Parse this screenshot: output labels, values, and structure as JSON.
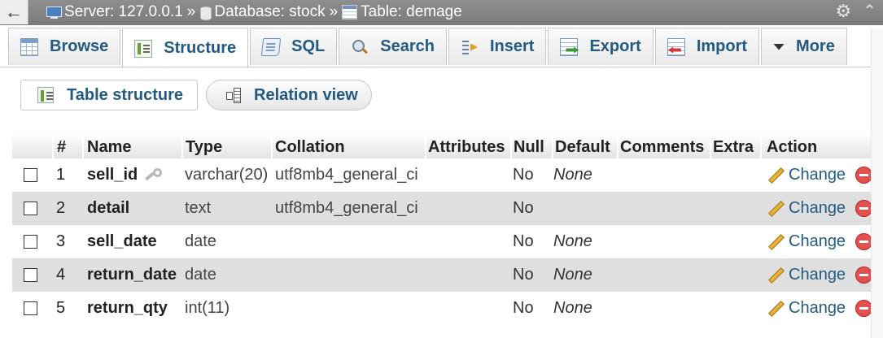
{
  "topbar": {
    "back_label": "←",
    "breadcrumbs": [
      {
        "label": "Server: 127.0.0.1",
        "icon": "server-icon"
      },
      {
        "label": "Database: stock",
        "icon": "database-icon"
      },
      {
        "label": "Table: demage",
        "icon": "table-icon"
      }
    ],
    "separator": "»",
    "settings_icon": "gear-icon",
    "collapse_icon": "collapse-icon"
  },
  "tabs": [
    {
      "label": "Browse",
      "icon": "browse-icon",
      "active": false
    },
    {
      "label": "Structure",
      "icon": "structure-icon",
      "active": true
    },
    {
      "label": "SQL",
      "icon": "sql-icon",
      "active": false
    },
    {
      "label": "Search",
      "icon": "search-icon",
      "active": false
    },
    {
      "label": "Insert",
      "icon": "insert-icon",
      "active": false
    },
    {
      "label": "Export",
      "icon": "export-icon",
      "active": false
    },
    {
      "label": "Import",
      "icon": "import-icon",
      "active": false
    },
    {
      "label": "More",
      "icon": "caret-down-icon",
      "active": false
    }
  ],
  "subtabs": {
    "table_structure": "Table structure",
    "relation_view": "Relation view"
  },
  "columns": {
    "num": "#",
    "name": "Name",
    "type": "Type",
    "collation": "Collation",
    "attributes": "Attributes",
    "null": "Null",
    "default": "Default",
    "comments": "Comments",
    "extra": "Extra",
    "action": "Action"
  },
  "rows": [
    {
      "num": "1",
      "name": "sell_id",
      "type": "varchar(20)",
      "collation": "utf8mb4_general_ci",
      "attributes": "",
      "null": "No",
      "default": "None",
      "comments": "",
      "extra": "",
      "action": "Change",
      "primary_key": true
    },
    {
      "num": "2",
      "name": "detail",
      "type": "text",
      "collation": "utf8mb4_general_ci",
      "attributes": "",
      "null": "No",
      "default": "",
      "comments": "",
      "extra": "",
      "action": "Change",
      "primary_key": false
    },
    {
      "num": "3",
      "name": "sell_date",
      "type": "date",
      "collation": "",
      "attributes": "",
      "null": "No",
      "default": "None",
      "comments": "",
      "extra": "",
      "action": "Change",
      "primary_key": false
    },
    {
      "num": "4",
      "name": "return_date",
      "type": "date",
      "collation": "",
      "attributes": "",
      "null": "No",
      "default": "None",
      "comments": "",
      "extra": "",
      "action": "Change",
      "primary_key": false
    },
    {
      "num": "5",
      "name": "return_qty",
      "type": "int(11)",
      "collation": "",
      "attributes": "",
      "null": "No",
      "default": "None",
      "comments": "",
      "extra": "",
      "action": "Change",
      "primary_key": false
    }
  ],
  "colors": {
    "link": "#235a81",
    "topbar": "#858585",
    "row_alt": "#dfdfdf",
    "drop": "#e25050"
  }
}
